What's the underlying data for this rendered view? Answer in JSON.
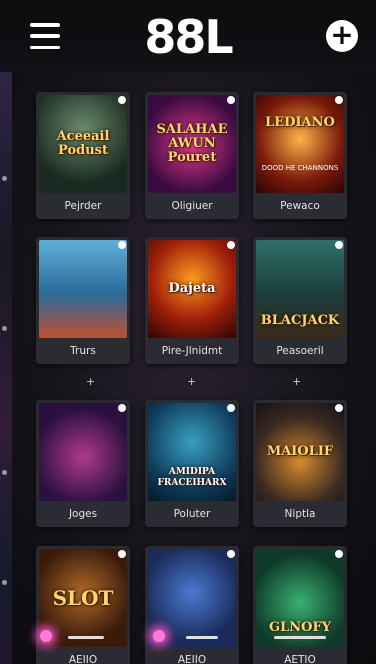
{
  "header": {
    "logo": "88L",
    "menu_icon": "hamburger-menu-icon",
    "add_icon": "plus-circle-icon"
  },
  "games": [
    {
      "art_title": "Aceeail Podust",
      "caption": "Pejrder"
    },
    {
      "art_title": "SALAHAE AWUN Pouret",
      "caption": "Oligiuer"
    },
    {
      "art_title": "LEDIANO",
      "caption": "Pewaco"
    },
    {
      "art_title": "",
      "caption": "Trurs"
    },
    {
      "art_title": "Dajeta",
      "caption": "Pire-Jlnidmt"
    },
    {
      "art_title": "BLACJACK",
      "caption": "Peasoeril"
    },
    {
      "art_title": "",
      "caption": "Joges"
    },
    {
      "art_title": "AMIDIPA FRACEIHARX",
      "caption": "Poluter"
    },
    {
      "art_title": "MAIOLIF",
      "caption": "Niptla"
    },
    {
      "art_title": "SLOT",
      "caption": "AEIIO"
    },
    {
      "art_title": "",
      "caption": "AEIIO"
    },
    {
      "art_title": "GLNOFY",
      "caption": "AETIO"
    }
  ],
  "card3_sub": "DOOD HE CHANNONS",
  "separators": [
    "+",
    "+",
    "+"
  ],
  "colors": {
    "background": "#15141a",
    "card": "#2a2a31",
    "accent_glow": "#ff57c8"
  }
}
